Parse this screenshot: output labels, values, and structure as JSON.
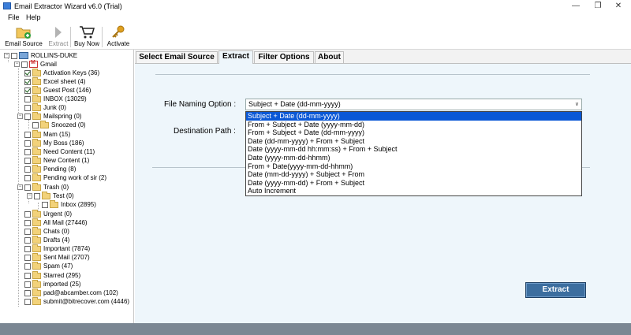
{
  "window": {
    "title": "Email Extractor Wizard v6.0 (Trial)"
  },
  "menu": {
    "file": "File",
    "help": "Help"
  },
  "toolbar": {
    "email_source": "Email Source",
    "extract": "Extract",
    "buy_now": "Buy Now",
    "activate": "Activate"
  },
  "tree": {
    "root": "ROLLINS-DUKE",
    "account": "Gmail",
    "items": [
      "Activation Keys (36)",
      "Excel sheet (4)",
      "Guest Post (146)",
      "INBOX (13029)",
      "Junk (0)",
      "Mailspring (0)",
      "Snoozed (0)",
      "Mam (15)",
      "My Boss (186)",
      "Need Content (11)",
      "New Content (1)",
      "Pending (8)",
      "Pending work of sir (2)",
      "Trash (0)",
      "Test (0)",
      "Inbox (2895)",
      "Urgent (0)",
      "All Mail (27446)",
      "Chats (0)",
      "Drafts (4)",
      "Important (7874)",
      "Sent Mail (2707)",
      "Spam (47)",
      "Starred (295)",
      "imported (25)",
      "pad@abcamber.com (102)",
      "submit@bitrecover.com (4446)"
    ]
  },
  "tabs": {
    "select_source": "Select Email Source",
    "extract": "Extract",
    "filter": "Filter Options",
    "about": "About"
  },
  "form": {
    "file_naming_label": "File Naming Option :",
    "destination_label": "Destination Path :",
    "selected_option": "Subject + Date (dd-mm-yyyy)",
    "options": [
      "Subject + Date (dd-mm-yyyy)",
      "From + Subject + Date (yyyy-mm-dd)",
      "From + Subject + Date (dd-mm-yyyy)",
      "Date (dd-mm-yyyy) + From + Subject",
      "Date (yyyy-mm-dd hh:mm:ss) + From + Subject",
      "Date (yyyy-mm-dd-hhmm)",
      "From + Date(yyyy-mm-dd-hhmm)",
      "Date (mm-dd-yyyy) + Subject + From",
      "Date (yyyy-mm-dd) + From + Subject",
      "Auto Increment"
    ],
    "extract_button": "Extract"
  },
  "colors": {
    "selection": "#0a58d6",
    "button": "#3c6e9f",
    "panel": "#eef6fb"
  }
}
